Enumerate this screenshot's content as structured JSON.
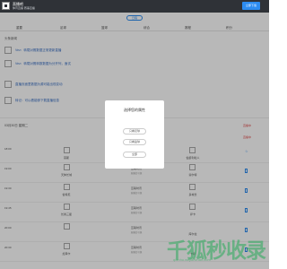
{
  "header": {
    "app_title": "直播吧",
    "app_subtitle": "体育直播 赛事直播",
    "open_button": "立即下载"
  },
  "date_pill": "日程",
  "tabs": [
    "重要",
    "足球",
    "篮球",
    "综合",
    "赛程",
    "积分"
  ],
  "section_title": "头条新闻",
  "notices": [
    "Vez：转载对照数据正常更新直播",
    "Vez：转载对照转数数据为分开列，面试",
    "直播页面里数据为源可能出现变动",
    "转记：可以看能够下载直播信息"
  ],
  "date_label": "03月30日 星期二",
  "red_tags": [
    "直播中",
    "直播中"
  ],
  "rows": [
    {
      "time": "18:00",
      "home": "莫斯",
      "mid": "",
      "mid_sub": "",
      "away": "伯爵利哈人"
    },
    {
      "time": "19:00",
      "home": "天体长城",
      "mid": "互联时讯",
      "mid_sub": "直播信号源",
      "away": "塞尔特"
    },
    {
      "time": "19:30",
      "home": "伯特尼",
      "mid": "互联时讯",
      "mid_sub": "直播信号源",
      "away": "多城长"
    },
    {
      "time": "19:45",
      "home": "长春三星",
      "mid": "互联时讯",
      "mid_sub": "直播信号源",
      "away": "萨卡"
    },
    {
      "time": "20:00",
      "home": "",
      "mid": "互联时讯",
      "mid_sub": "直播信号源",
      "away": "库尔拉"
    },
    {
      "time": "20:30",
      "home": "加泽卡",
      "mid": "互联时讯",
      "mid_sub": "直播信号源",
      "away": "卡萨"
    }
  ],
  "modal": {
    "title": "选择您的属性",
    "options": [
      "只看足球",
      "只看篮球",
      "全部"
    ]
  },
  "watermark": {
    "text": "千狐秒收录",
    "sub": "qianhu.wejianzhan.com"
  }
}
